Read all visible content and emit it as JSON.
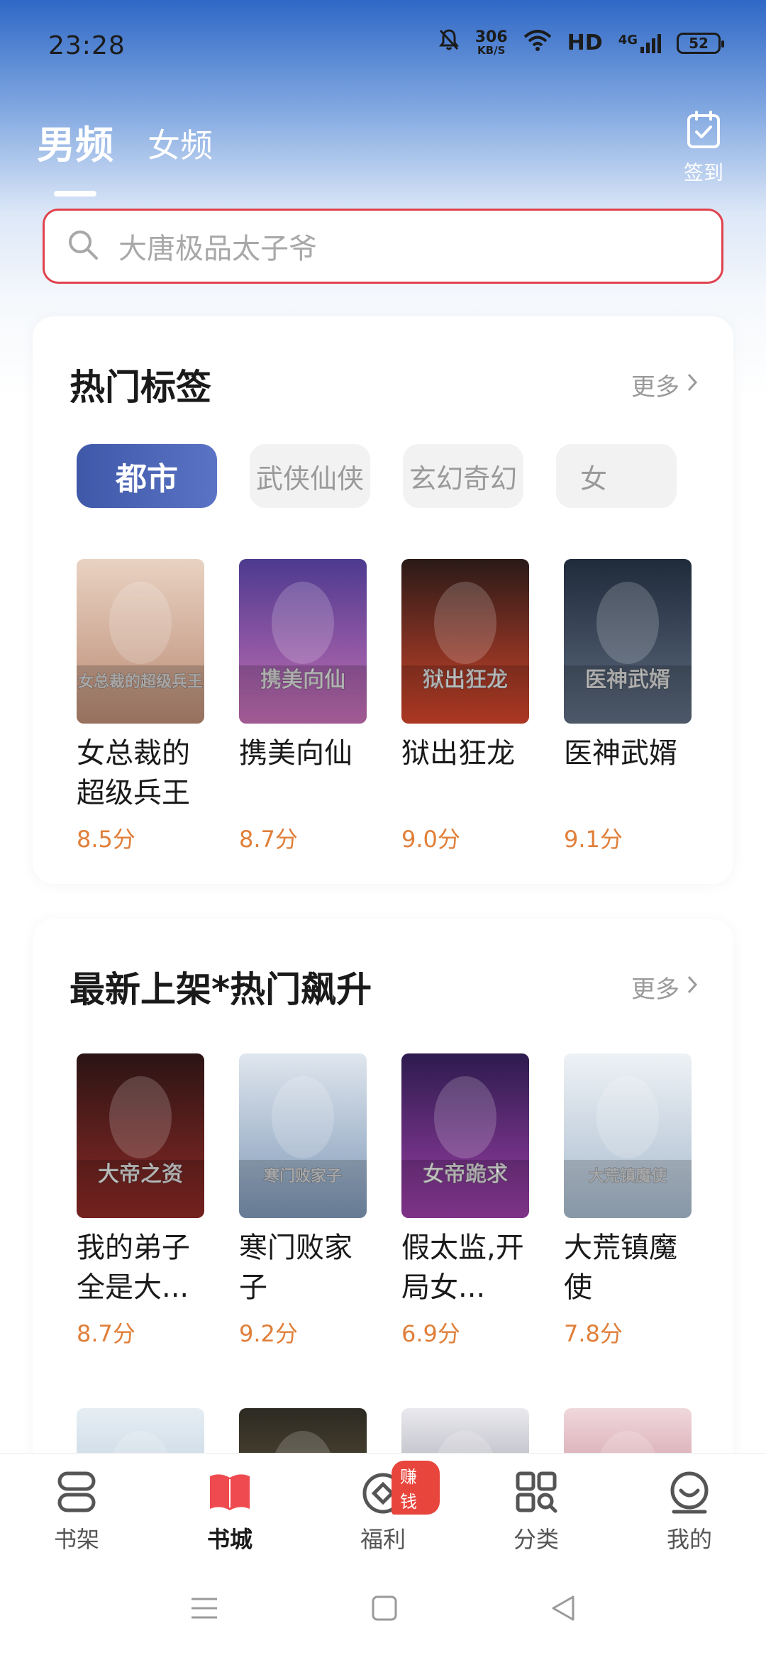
{
  "status_bar": {
    "time": "23:28",
    "net_speed_value": "306",
    "net_speed_unit": "KB/S",
    "hd_label": "HD",
    "network_type": "4G",
    "battery_level": "52"
  },
  "header": {
    "tabs": [
      {
        "label": "男频",
        "active": true
      },
      {
        "label": "女频",
        "active": false
      }
    ],
    "checkin_label": "签到"
  },
  "search": {
    "placeholder": "大唐极品太子爷"
  },
  "hot_tags": {
    "title": "热门标签",
    "more_label": "更多",
    "chips": [
      {
        "label": "都市",
        "active": true
      },
      {
        "label": "武侠仙侠",
        "active": false
      },
      {
        "label": "玄幻奇幻",
        "active": false
      },
      {
        "label": "女",
        "active": false
      }
    ],
    "books": [
      {
        "title": "女总裁的超级兵王",
        "score": "8.5分",
        "cover_text": "女总裁的超级兵王",
        "cover_colors": [
          "#e9d2c2",
          "#b98a73"
        ]
      },
      {
        "title": "携美向仙",
        "score": "8.7分",
        "cover_text": "携美向仙",
        "cover_colors": [
          "#4d3a8f",
          "#c66fb4"
        ]
      },
      {
        "title": "狱出狂龙",
        "score": "9.0分",
        "cover_text": "狱出狂龙",
        "cover_colors": [
          "#2a1a18",
          "#d2452b"
        ]
      },
      {
        "title": "医神武婿",
        "score": "9.1分",
        "cover_text": "医神武婿",
        "cover_colors": [
          "#1f2a3a",
          "#5e6c80"
        ]
      }
    ]
  },
  "new_arrivals": {
    "title": "最新上架*热门飙升",
    "more_label": "更多",
    "books": [
      {
        "title": "我的弟子全是大...",
        "score": "8.7分",
        "cover_text": "大帝之资",
        "cover_colors": [
          "#2b1414",
          "#8e2a26"
        ]
      },
      {
        "title": "寒门败家子",
        "score": "9.2分",
        "cover_text": "寒门败家子",
        "cover_colors": [
          "#dfe6ee",
          "#7d97b6"
        ]
      },
      {
        "title": "假太监,开局女...",
        "score": "6.9分",
        "cover_text": "女帝跪求",
        "cover_colors": [
          "#2d1b4e",
          "#9b3fa6"
        ]
      },
      {
        "title": "大荒镇魔使",
        "score": "7.8分",
        "cover_text": "大荒镇魔使",
        "cover_colors": [
          "#eef2f6",
          "#a6b9cc"
        ]
      }
    ]
  },
  "peek_covers": [
    {
      "colors": [
        "#e6eef4",
        "#9fb7cc"
      ]
    },
    {
      "colors": [
        "#2c2a22",
        "#7c6b4a"
      ]
    },
    {
      "colors": [
        "#e9e9ee",
        "#6f6f80"
      ]
    },
    {
      "colors": [
        "#efd8dc",
        "#b25a6d"
      ]
    }
  ],
  "bottom_nav": {
    "items": [
      {
        "label": "书架",
        "icon": "bookshelf-icon",
        "active": false
      },
      {
        "label": "书城",
        "icon": "bookstore-icon",
        "active": true
      },
      {
        "label": "福利",
        "icon": "welfare-coin-icon",
        "active": false,
        "badge": "赚钱"
      },
      {
        "label": "分类",
        "icon": "category-grid-icon",
        "active": false
      },
      {
        "label": "我的",
        "icon": "profile-smile-icon",
        "active": false
      }
    ]
  },
  "colors": {
    "accent_red": "#e0424d",
    "score_orange": "#e07f3a",
    "chip_active": "#3f58a8",
    "header_blue": "#2f68c6"
  }
}
